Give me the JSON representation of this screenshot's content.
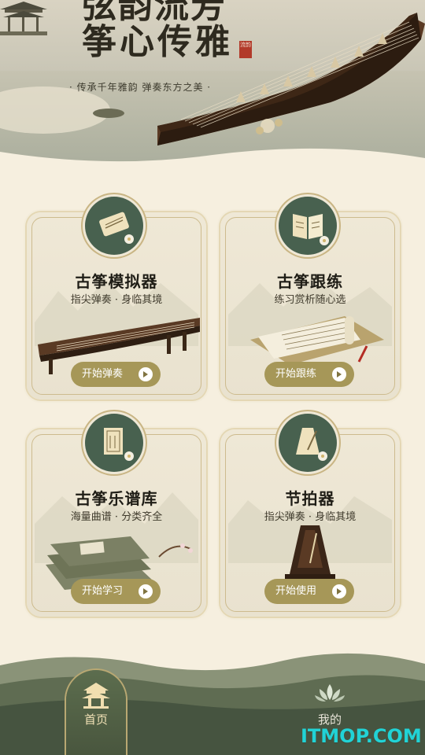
{
  "banner": {
    "title_line1": "弦韵流芳",
    "title_line2": "筝心传雅",
    "seal_text": "流韵",
    "slogan": "· 传承千年雅韵   弹奏东方之美 ·"
  },
  "cards": [
    {
      "title": "古筝模拟器",
      "subtitle": "指尖弹奏 · 身临其境",
      "button": "开始弹奏",
      "icon": "scroll-icon"
    },
    {
      "title": "古筝跟练",
      "subtitle": "练习赏析随心选",
      "button": "开始跟练",
      "icon": "book-icon"
    },
    {
      "title": "古筝乐谱库",
      "subtitle": "海量曲谱 · 分类齐全",
      "button": "开始学习",
      "icon": "sheet-music-icon"
    },
    {
      "title": "节拍器",
      "subtitle": "指尖弹奏 · 身临其境",
      "button": "开始使用",
      "icon": "metronome-icon"
    }
  ],
  "nav": {
    "home": "首页",
    "mine": "我的"
  },
  "watermark": "ITMOP.COM",
  "colors": {
    "accent_green": "#48614f",
    "button_gold": "#a69758",
    "card_bg": "#efe8d6",
    "page_bg": "#f6efdf"
  }
}
